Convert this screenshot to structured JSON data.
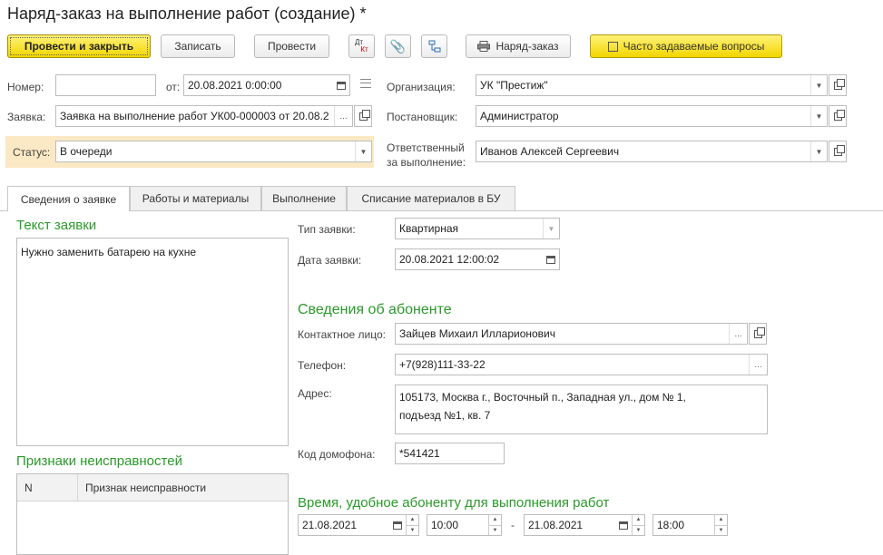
{
  "window": {
    "title": "Наряд-заказ на выполнение работ (создание) *"
  },
  "toolbar": {
    "post_close": "Провести и закрыть",
    "save": "Записать",
    "post": "Провести",
    "dtkt_top": "Дт",
    "dtkt_bottom": "Кт",
    "print_order": "Наряд-заказ",
    "faq": "Часто задаваемые вопросы"
  },
  "header": {
    "number_label": "Номер:",
    "number_value": "",
    "from_label": "от:",
    "date_value": "20.08.2021  0:00:00",
    "request_label": "Заявка:",
    "request_value": "Заявка на выполнение работ УК00-000003 от 20.08.2",
    "status_label": "Статус:",
    "status_value": "В очереди",
    "org_label": "Организация:",
    "org_value": "УК \"Престиж\"",
    "author_label": "Постановщик:",
    "author_value": "Администратор",
    "responsible_label_1": "Ответственный",
    "responsible_label_2": "за выполнение:",
    "responsible_value": "Иванов Алексей Сергеевич"
  },
  "tabs": [
    {
      "label": "Сведения о заявке",
      "active": true
    },
    {
      "label": "Работы и материалы",
      "active": false
    },
    {
      "label": "Выполнение",
      "active": false
    },
    {
      "label": "Списание материалов в БУ",
      "active": false
    }
  ],
  "request_info": {
    "text_heading": "Текст заявки",
    "text_value": "Нужно заменить батарею на кухне",
    "type_label": "Тип заявки:",
    "type_value": "Квартирная",
    "date_label": "Дата заявки:",
    "date_value": "20.08.2021 12:00:02"
  },
  "faults": {
    "heading": "Признаки неисправностей",
    "col_n": "N",
    "col_sign": "Признак неисправности"
  },
  "subscriber": {
    "heading": "Сведения об абоненте",
    "contact_label": "Контактное лицо:",
    "contact_value": "Зайцев Михаил Илларионович",
    "phone_label": "Телефон:",
    "phone_value": "+7(928)111-33-22",
    "address_label": "Адрес:",
    "address_line1": "105173, Москва г., Восточный п., Западная ул., дом № 1,",
    "address_line2": "подъезд №1, кв. 7",
    "intercom_label": "Код домофона:",
    "intercom_value": "*541421"
  },
  "time": {
    "heading": "Время, удобное абоненту для выполнения работ",
    "date_from": "21.08.2021",
    "time_from": "10:00",
    "dash": "-",
    "date_to": "21.08.2021",
    "time_to": "18:00"
  },
  "colors": {
    "accent_green": "#2a9a2a",
    "primary_yellow": "#f2d600",
    "status_highlight": "#fbe8c4"
  }
}
